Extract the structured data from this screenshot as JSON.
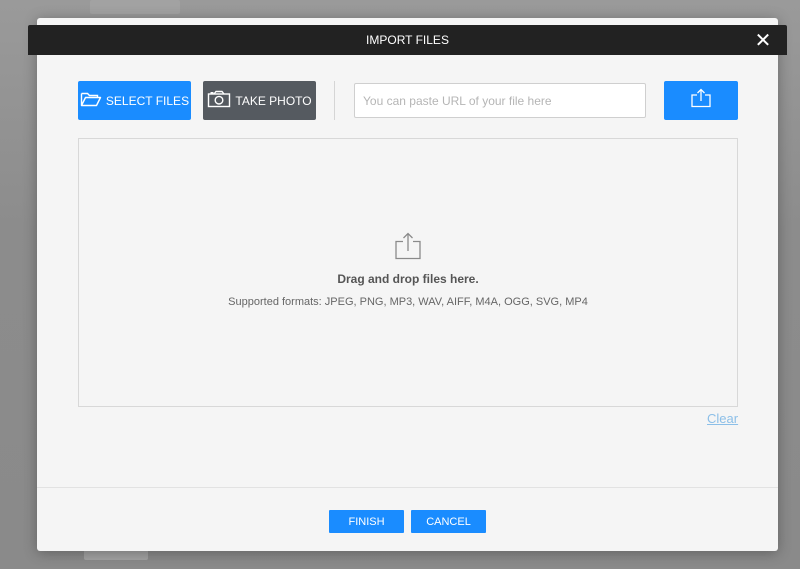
{
  "dialog": {
    "title": "IMPORT FILES",
    "close_glyph": "✕"
  },
  "toolbar": {
    "select_files_label": "SELECT FILES",
    "select_files_icon": "folder-open-icon",
    "take_photo_label": "TAKE PHOTO",
    "take_photo_icon": "camera-icon",
    "url_placeholder": "You can paste URL of your file here",
    "url_value": "",
    "upload_icon": "upload-icon"
  },
  "dropzone": {
    "icon": "upload-icon",
    "title": "Drag and drop files here.",
    "formats": "Supported formats: JPEG, PNG, MP3, WAV, AIFF, M4A, OGG, SVG, MP4"
  },
  "clear_label": "Clear",
  "footer": {
    "finish_label": "FINISH",
    "cancel_label": "CANCEL"
  },
  "colors": {
    "accent": "#1a8cff",
    "titlebar": "#222222",
    "secondary_button": "#555a60",
    "dialog_bg": "#f5f5f5",
    "link": "#8cbfe8"
  }
}
